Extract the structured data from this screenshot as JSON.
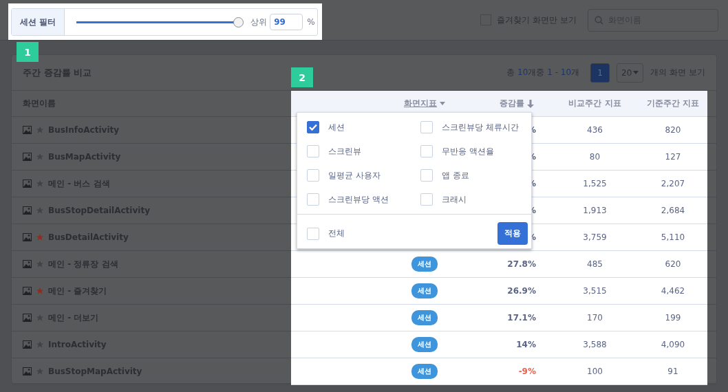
{
  "filter": {
    "label": "세션 필터",
    "level": 1,
    "prefix": "상위",
    "value": "99",
    "unit": "%"
  },
  "favorites_only": {
    "label": "즐겨찾기 화면만 보기",
    "checked": false
  },
  "search": {
    "placeholder": "화면이름"
  },
  "callouts": [
    "1",
    "2"
  ],
  "card": {
    "title": "주간 증감률 비교",
    "summary": {
      "prefix": "총",
      "total": "10",
      "middle": "개중",
      "range": "1 - 10",
      "suffix": "개"
    },
    "pages": [
      {
        "label": "1",
        "selected": true
      }
    ],
    "page_size": "20",
    "page_size_suffix": "개의 화면 보기"
  },
  "columns": [
    {
      "label": "화면이름",
      "kind": "plain"
    },
    {
      "label": "화면지표",
      "kind": "dropdown"
    },
    {
      "label": "증감률",
      "kind": "sorted"
    },
    {
      "label": "비교주간 지표",
      "kind": "plain"
    },
    {
      "label": "기준주간 지표",
      "kind": "plain"
    }
  ],
  "rows": [
    {
      "name": "BusInfoActivity",
      "favorite": false,
      "rate": "%",
      "negative": false,
      "compare": "436",
      "base": "820"
    },
    {
      "name": "BusMapActivity",
      "favorite": false,
      "rate": "%",
      "negative": false,
      "compare": "80",
      "base": "127"
    },
    {
      "name": "메인 - 버스 검색",
      "favorite": false,
      "rate": "%",
      "negative": false,
      "compare": "1,525",
      "base": "2,207"
    },
    {
      "name": "BusStopDetailActivity",
      "favorite": false,
      "rate": "%",
      "negative": false,
      "compare": "1,913",
      "base": "2,684"
    },
    {
      "name": "BusDetailActivity",
      "favorite": true,
      "rate": "%",
      "negative": false,
      "compare": "3,759",
      "base": "5,110"
    },
    {
      "name": "메인 - 정류장 검색",
      "favorite": false,
      "metric": "세션",
      "rate": "27.8%",
      "negative": false,
      "compare": "485",
      "base": "620"
    },
    {
      "name": "메인 - 즐겨찾기",
      "favorite": true,
      "metric": "세션",
      "rate": "26.9%",
      "negative": false,
      "compare": "3,515",
      "base": "4,462"
    },
    {
      "name": "메인 - 더보기",
      "favorite": false,
      "metric": "세션",
      "rate": "17.1%",
      "negative": false,
      "compare": "170",
      "base": "199"
    },
    {
      "name": "IntroActivity",
      "favorite": false,
      "metric": "세션",
      "rate": "14%",
      "negative": false,
      "compare": "3,588",
      "base": "4,090"
    },
    {
      "name": "BusStopMapActivity",
      "favorite": false,
      "metric": "세션",
      "rate": "-9%",
      "negative": true,
      "compare": "100",
      "base": "91"
    }
  ],
  "metric_menu": {
    "options": [
      {
        "label": "세션",
        "checked": true
      },
      {
        "label": "스크린뷰당 체류시간",
        "checked": false
      },
      {
        "label": "스크린뷰",
        "checked": false
      },
      {
        "label": "무반응 액션율",
        "checked": false
      },
      {
        "label": "일평균 사용자",
        "checked": false
      },
      {
        "label": "앱 종료",
        "checked": false
      },
      {
        "label": "스크린뷰당 액션",
        "checked": false
      },
      {
        "label": "크래시",
        "checked": false
      }
    ],
    "all": {
      "label": "전체",
      "checked": false
    },
    "apply": "적용"
  }
}
